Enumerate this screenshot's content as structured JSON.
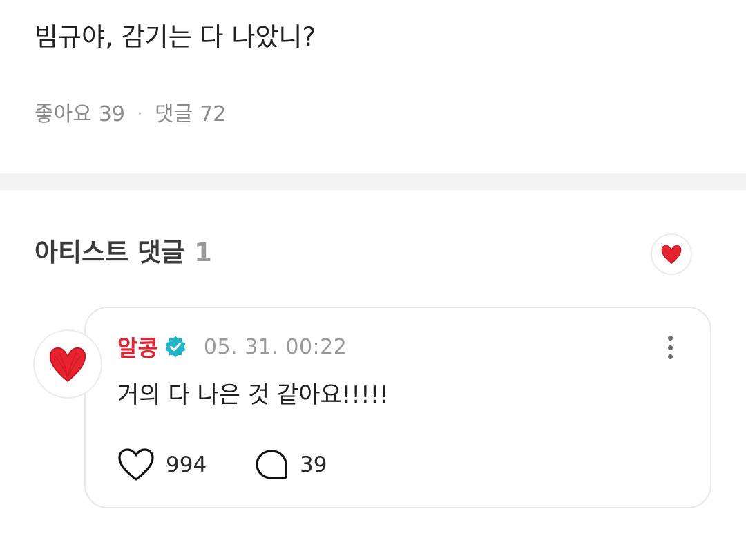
{
  "post": {
    "text": "빔규야, 감기는 다 나았니?",
    "likes_label": "좋아요",
    "likes_count": "39",
    "separator": "·",
    "comments_label": "댓글",
    "comments_count": "72"
  },
  "artist_section": {
    "title": "아티스트 댓글",
    "count": "1"
  },
  "comment": {
    "author": "알콩",
    "timestamp": "05. 31. 00:22",
    "text": "거의 다 나은 것 같아요!!!!!",
    "like_count": "994",
    "reply_count": "39"
  },
  "colors": {
    "author": "#e5202f",
    "verified": "#1fb5c9",
    "heart": "#e8232f"
  }
}
